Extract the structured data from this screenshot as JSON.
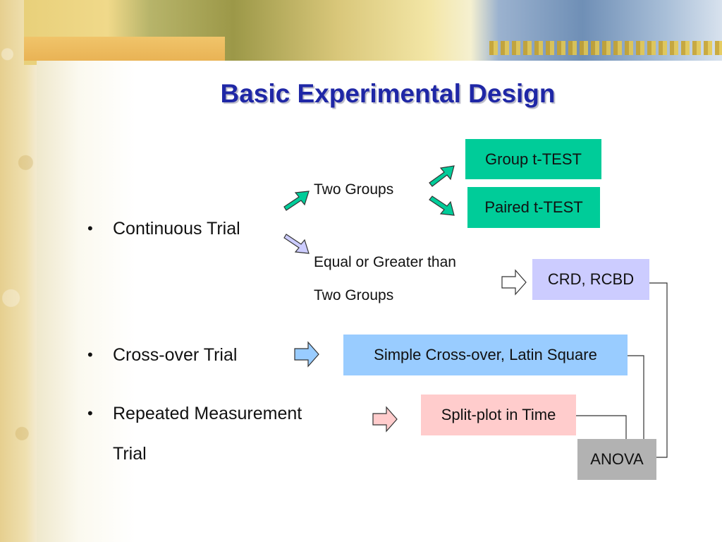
{
  "slide": {
    "title": "Basic Experimental Design",
    "bullets": [
      "Continuous Trial",
      "Cross-over Trial",
      "Repeated Measurement",
      "Trial"
    ],
    "bullet_symbol": "•"
  },
  "labels": {
    "two_groups": "Two Groups",
    "equal_or_greater_line1": "Equal or Greater than",
    "equal_or_greater_line2": "Two Groups"
  },
  "boxes": {
    "group_t_test": "Group t-TEST",
    "paired_t_test": "Paired t-TEST",
    "crd_rcbd": "CRD, RCBD",
    "simple_crossover": "Simple Cross-over, Latin Square",
    "split_plot": "Split-plot in Time",
    "anova": "ANOVA"
  },
  "colors": {
    "title": "#1f27a6",
    "green_box": "#00cc99",
    "lavender_box": "#ccccff",
    "blue_box": "#99ccff",
    "pink_box": "#ffcccc",
    "gray_box": "#b2b2b2"
  }
}
